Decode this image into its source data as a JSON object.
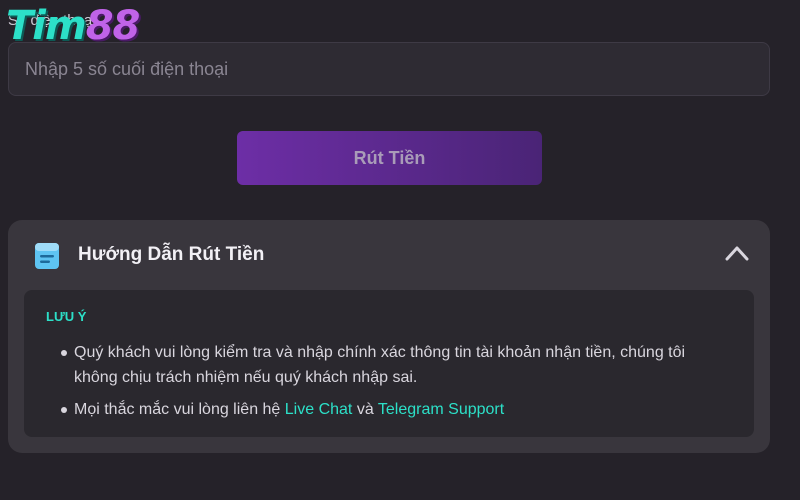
{
  "form": {
    "phone_label": "Số điện thoại",
    "phone_value": "",
    "phone_placeholder": "Nhập 5 số cuối điện thoại",
    "submit_label": "Rút Tiền"
  },
  "logo": {
    "part1": "Tim",
    "part2": "88"
  },
  "guide": {
    "title": "Hướng Dẫn Rút Tiền",
    "icon": "document-icon",
    "toggle_icon": "chevron-up-icon",
    "expanded": true,
    "note_heading": "LƯU Ý",
    "items": [
      {
        "text": "Quý khách vui lòng kiểm tra và nhập chính xác thông tin tài khoản nhận tiền, chúng tôi không chịu trách nhiệm nếu quý khách nhập sai."
      },
      {
        "prefix": "Mọi thắc mắc vui lòng liên hệ",
        "link1": "Live Chat",
        "middle": "và",
        "link2": "Telegram Support"
      }
    ]
  },
  "colors": {
    "background": "#252229",
    "card": "#39363d",
    "note_box": "#2a282e",
    "accent": "#2ce0c8",
    "button_gradient_start": "#6d2ea6",
    "button_gradient_end": "#4a2476",
    "logo_secondary": "#c063e8"
  }
}
